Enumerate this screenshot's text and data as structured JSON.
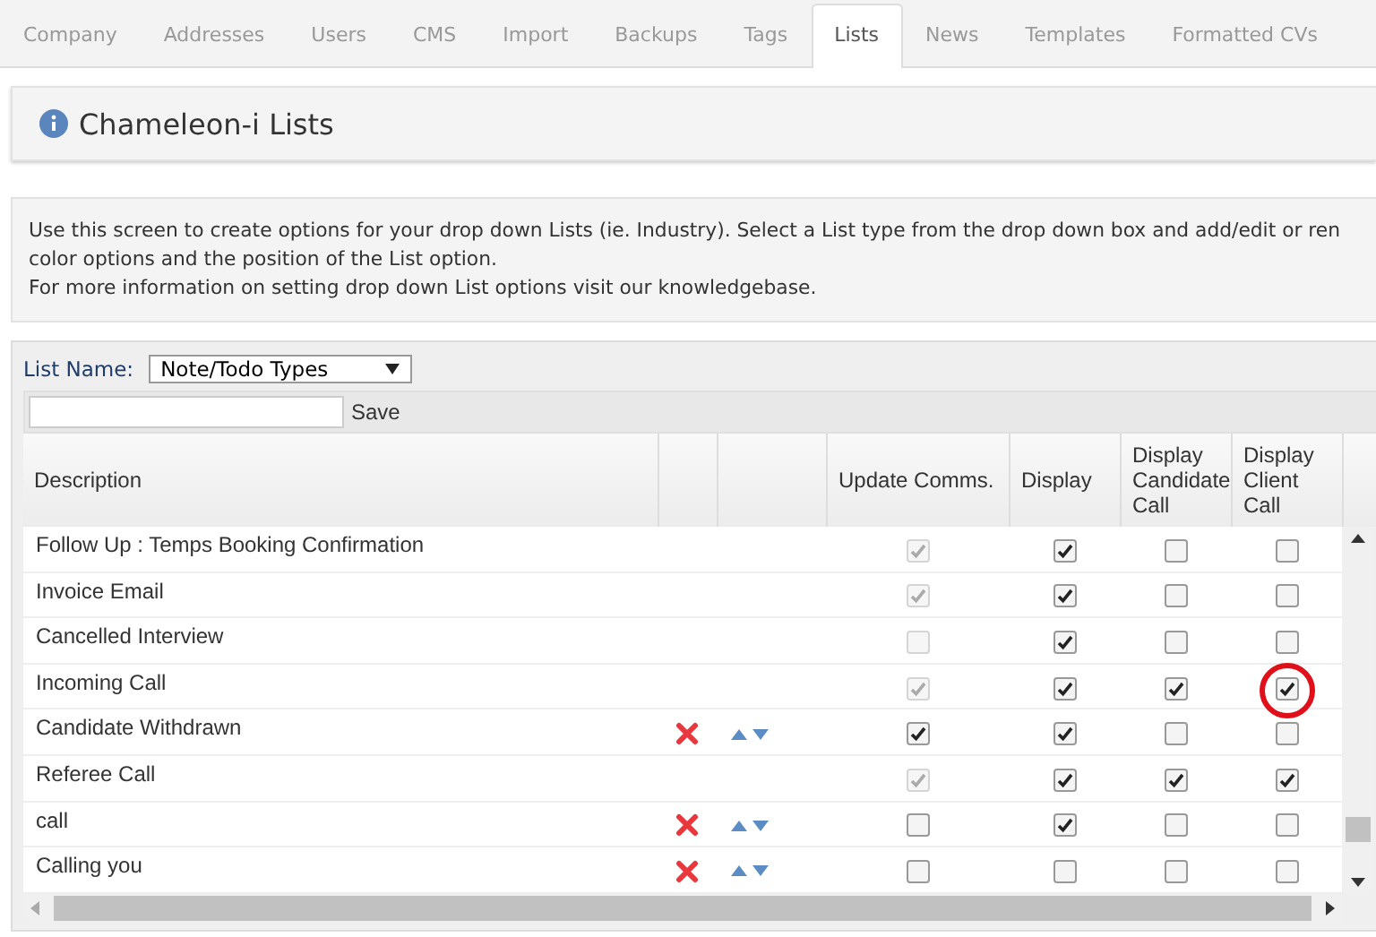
{
  "tabs": [
    {
      "label": "Company",
      "selected": false
    },
    {
      "label": "Addresses",
      "selected": false
    },
    {
      "label": "Users",
      "selected": false
    },
    {
      "label": "CMS",
      "selected": false
    },
    {
      "label": "Import",
      "selected": false
    },
    {
      "label": "Backups",
      "selected": false
    },
    {
      "label": "Tags",
      "selected": false
    },
    {
      "label": "Lists",
      "selected": true
    },
    {
      "label": "News",
      "selected": false
    },
    {
      "label": "Templates",
      "selected": false
    },
    {
      "label": "Formatted CVs",
      "selected": false
    }
  ],
  "header": {
    "title": "Chameleon-i Lists"
  },
  "intro": [
    "Use this screen to create options for your drop down Lists (ie. Industry). Select a List type from the drop down box and add/edit or ren",
    "color options and the position of the List option.",
    "For more information on setting drop down List options visit our knowledgebase."
  ],
  "list_name": {
    "label": "List Name:",
    "value": "Note/Todo Types"
  },
  "save_button": "Save",
  "table": {
    "columns": [
      "Description",
      "",
      "",
      "Update Comms.",
      "Display",
      "Display Candidate Call",
      "Display Client Call"
    ],
    "rows": [
      {
        "description": "Follow Up : Temps Booking Confirmation",
        "editable": false,
        "update_comms": {
          "checked": true,
          "disabled": true
        },
        "display": true,
        "display_candidate_call": false,
        "display_client_call": false,
        "highlighted": false
      },
      {
        "description": "Invoice Email",
        "editable": false,
        "update_comms": {
          "checked": true,
          "disabled": true
        },
        "display": true,
        "display_candidate_call": false,
        "display_client_call": false,
        "highlighted": false
      },
      {
        "description": "Cancelled Interview",
        "editable": false,
        "update_comms": {
          "checked": false,
          "disabled": true
        },
        "display": true,
        "display_candidate_call": false,
        "display_client_call": false,
        "highlighted": false
      },
      {
        "description": "Incoming Call",
        "editable": false,
        "update_comms": {
          "checked": true,
          "disabled": true
        },
        "display": true,
        "display_candidate_call": true,
        "display_client_call": true,
        "highlighted": true
      },
      {
        "description": "Candidate Withdrawn",
        "editable": true,
        "update_comms": {
          "checked": true,
          "disabled": false
        },
        "display": true,
        "display_candidate_call": false,
        "display_client_call": false,
        "highlighted": false
      },
      {
        "description": "Referee Call",
        "editable": false,
        "update_comms": {
          "checked": true,
          "disabled": true
        },
        "display": true,
        "display_candidate_call": true,
        "display_client_call": true,
        "highlighted": false
      },
      {
        "description": "call",
        "editable": true,
        "update_comms": {
          "checked": false,
          "disabled": false
        },
        "display": true,
        "display_candidate_call": false,
        "display_client_call": false,
        "highlighted": false
      },
      {
        "description": "Calling you",
        "editable": true,
        "update_comms": {
          "checked": false,
          "disabled": false
        },
        "display": false,
        "display_candidate_call": false,
        "display_client_call": false,
        "highlighted": false
      }
    ]
  }
}
